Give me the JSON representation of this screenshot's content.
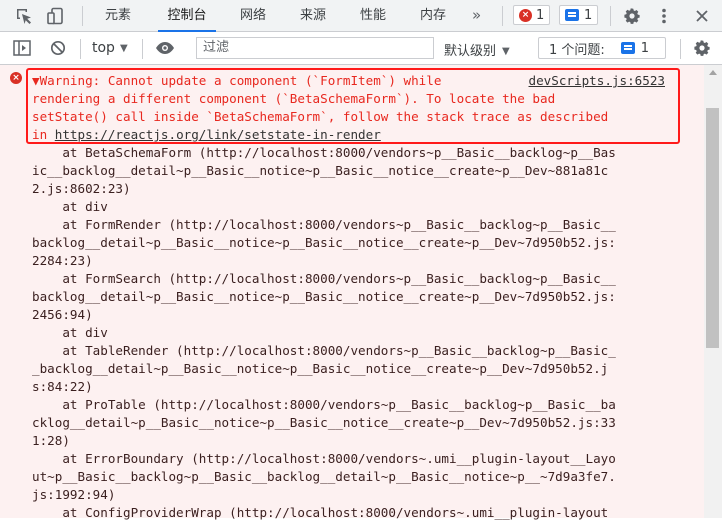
{
  "tabs": [
    {
      "label": "元素"
    },
    {
      "label": "控制台"
    },
    {
      "label": "网络"
    },
    {
      "label": "来源"
    },
    {
      "label": "性能"
    },
    {
      "label": "内存"
    }
  ],
  "more_tabs_glyph": "»",
  "error_badge_count": "1",
  "message_badge_count": "1",
  "toolbar": {
    "context": "top",
    "filter_placeholder": "过滤",
    "level": "默认级别",
    "issues_label": "1 个问题:",
    "issues_count": "1"
  },
  "console": {
    "source_link": "devScripts.js:6523",
    "warning_lines": [
      "▼Warning: Cannot update a component (`FormItem`) while",
      "rendering a different component (`BetaSchemaForm`). To locate the bad",
      "setState() call inside `BetaSchemaForm`, follow the stack trace as described"
    ],
    "warning_tail_prefix": "in ",
    "warning_tail_link": "https://reactjs.org/link/setstate-in-render",
    "stack_lines": [
      "    at BetaSchemaForm (http://localhost:8000/vendors~p__Basic__backlog~p__Bas",
      "ic__backlog__detail~p__Basic__notice~p__Basic__notice__create~p__Dev~881a81c",
      "2.js:8602:23)",
      "    at div",
      "    at FormRender (http://localhost:8000/vendors~p__Basic__backlog~p__Basic__",
      "backlog__detail~p__Basic__notice~p__Basic__notice__create~p__Dev~7d950b52.js:",
      "2284:23)",
      "    at FormSearch (http://localhost:8000/vendors~p__Basic__backlog~p__Basic__",
      "backlog__detail~p__Basic__notice~p__Basic__notice__create~p__Dev~7d950b52.js:",
      "2456:94)",
      "    at div",
      "    at TableRender (http://localhost:8000/vendors~p__Basic__backlog~p__Basic_",
      "_backlog__detail~p__Basic__notice~p__Basic__notice__create~p__Dev~7d950b52.j",
      "s:84:22)",
      "    at ProTable (http://localhost:8000/vendors~p__Basic__backlog~p__Basic__ba",
      "cklog__detail~p__Basic__notice~p__Basic__notice__create~p__Dev~7d950b52.js:33",
      "1:28)",
      "    at ErrorBoundary (http://localhost:8000/vendors~.umi__plugin-layout__Layo",
      "ut~p__Basic__backlog~p__Basic__backlog__detail~p__Basic__notice~p__~7d9a3fe7.",
      "js:1992:94)",
      "    at ConfigProviderWrap (http://localhost:8000/vendors~.umi__plugin-layout"
    ]
  }
}
